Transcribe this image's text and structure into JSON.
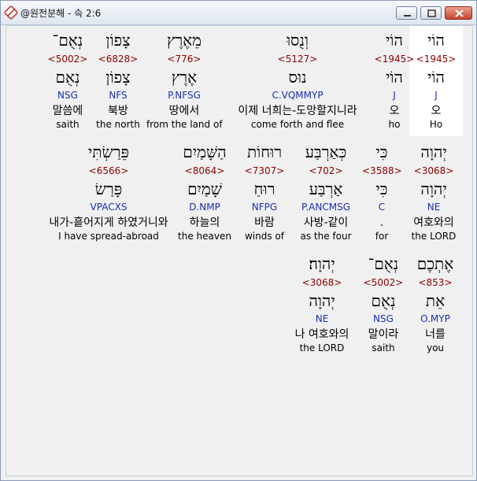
{
  "window": {
    "title": "@원전분해 - 슥 2:6"
  },
  "rows": [
    [
      {
        "heb": "הוֹי",
        "num": "<1945>",
        "lemma": "הוֹי",
        "morph": "J",
        "kor": "오",
        "eng": "Ho",
        "highlight": true
      },
      {
        "heb": "הוֹי",
        "num": "<1945>",
        "lemma": "הוֹי",
        "morph": "J",
        "kor": "오",
        "eng": "ho"
      },
      {
        "heb": "וְנֻסוּ",
        "num": "<5127>",
        "lemma": "נוּס",
        "morph": "C.VQMMYP",
        "kor": "이제 너희는-도망할지니라",
        "eng": "come forth and flee"
      },
      {
        "heb": "מֵאֶרֶץ",
        "num": "<776>",
        "lemma": "אֶרֶץ",
        "morph": "P.NFSG",
        "kor": "땅에서",
        "eng": "from the land of"
      },
      {
        "heb": "צָפוֹן",
        "num": "<6828>",
        "lemma": "צָפוֹן",
        "morph": "NFS",
        "kor": "북방",
        "eng": "the north"
      },
      {
        "heb": "נְאֻם־",
        "num": "<5002>",
        "lemma": "נְאֻם",
        "morph": "NSG",
        "kor": "말씀에",
        "eng": "saith"
      }
    ],
    [
      {
        "heb": "כִּי",
        "num": "<3588>",
        "lemma": "כִּי",
        "morph": "C",
        "kor": "",
        "eng": "for"
      },
      {
        "heb": "יְהוָה",
        "num": "<3068>",
        "lemma": "יְהוָה",
        "morph": "NE",
        "kor": "여호와의",
        "eng": "the LORD"
      },
      {
        "heb": "כְּאַרְבַּע",
        "num": "<702>",
        "lemma": "אַרְבַּע",
        "morph": "P.ANCMSG",
        "kor": "사방-같이",
        "eng": "as the four"
      },
      {
        "heb": "רוּחוֹת",
        "num": "<7307>",
        "lemma": "רוּחַ",
        "morph": "NFPG",
        "kor": "바람",
        "eng": "winds of"
      },
      {
        "heb": "הַשָּׁמַיִם",
        "num": "<8064>",
        "lemma": "שָׁמַיִם",
        "morph": "D.NMP",
        "kor": "하늘의",
        "eng": "the heaven"
      },
      {
        "heb": "פֵּרַשְׂתִּי",
        "num": "<6566>",
        "lemma": "פָּרַשׂ",
        "morph": "VPACXS",
        "kor": "내가-흩어지게 하였거니와",
        "eng": "I have spread-abroad"
      }
    ],
    [
      {
        "heb": "אֶתְכֶם",
        "num": "<853>",
        "lemma": "אֵת",
        "morph": "O.MYP",
        "kor": "너를",
        "eng": "you"
      },
      {
        "heb": "נְאֻם־",
        "num": "<5002>",
        "lemma": "נְאֻם",
        "morph": "NSG",
        "kor": "말이라",
        "eng": "saith"
      },
      {
        "heb": "יְהוָה׃",
        "num": "<3068>",
        "lemma": "יְהוָה",
        "morph": "NE",
        "kor": "나 여호와의",
        "eng": "the LORD"
      }
    ]
  ],
  "dot": "."
}
